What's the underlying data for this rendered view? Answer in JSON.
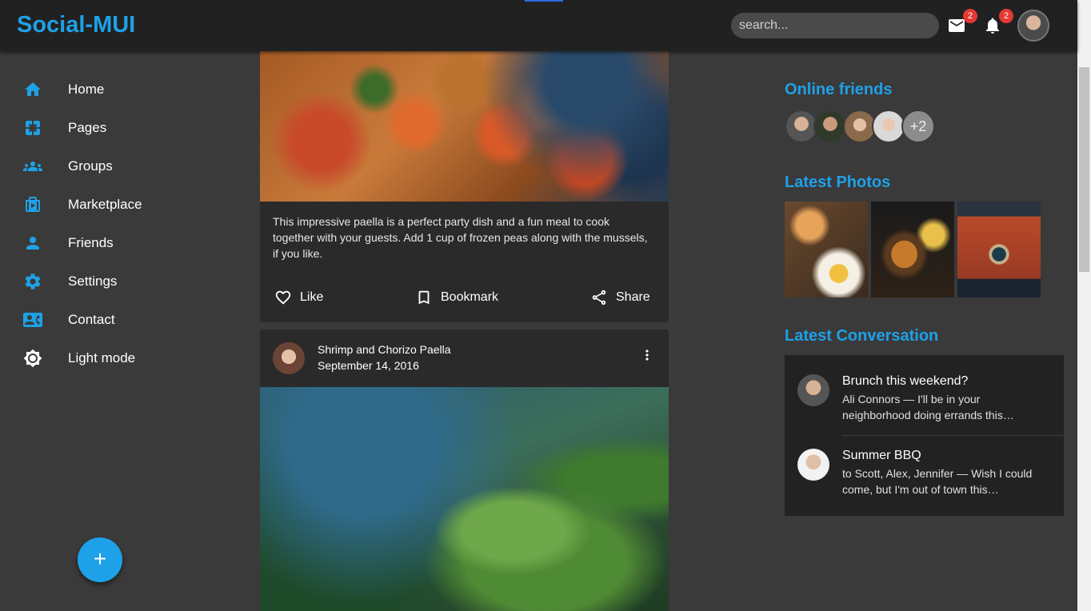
{
  "app": {
    "title": "Social-MUI"
  },
  "header": {
    "search_placeholder": "search...",
    "mail_badge": "2",
    "notifications_badge": "2"
  },
  "sidebar": {
    "items": [
      {
        "label": "Home",
        "icon": "home-icon"
      },
      {
        "label": "Pages",
        "icon": "pages-icon"
      },
      {
        "label": "Groups",
        "icon": "groups-icon"
      },
      {
        "label": "Marketplace",
        "icon": "storefront-icon"
      },
      {
        "label": "Friends",
        "icon": "person-icon"
      },
      {
        "label": "Settings",
        "icon": "gear-icon"
      },
      {
        "label": "Contact",
        "icon": "contact-card-icon"
      },
      {
        "label": "Light mode",
        "icon": "brightness-icon"
      }
    ],
    "fab_label": "+"
  },
  "feed": {
    "post1": {
      "caption": "This impressive paella is a perfect party dish and a fun meal to cook together with your guests. Add 1 cup of frozen peas along with the mussels, if you like.",
      "like_label": "Like",
      "bookmark_label": "Bookmark",
      "share_label": "Share"
    },
    "post2": {
      "title": "Shrimp and Chorizo Paella",
      "date": "September 14, 2016"
    }
  },
  "right": {
    "online_friends_title": "Online friends",
    "online_more": "+2",
    "latest_photos_title": "Latest Photos",
    "latest_conversation_title": "Latest Conversation",
    "conversations": [
      {
        "title": "Brunch this weekend?",
        "text": "Ali Connors — I'll be in your neighborhood doing errands this…"
      },
      {
        "title": "Summer BBQ",
        "text": "to Scott, Alex, Jennifer — Wish I could come, but I'm out of town this…"
      }
    ]
  },
  "colors": {
    "accent": "#1ea1e8",
    "background": "#3a3a3a",
    "appbar": "#212121",
    "card": "#2a2a2a",
    "badge": "#e53935"
  }
}
